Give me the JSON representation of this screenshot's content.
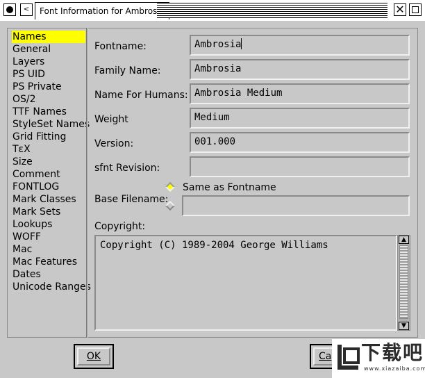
{
  "window": {
    "title": "Font Information for Ambrosia",
    "menu_glyph": "<",
    "close_glyph": "✕"
  },
  "sidebar": {
    "items": [
      {
        "label": "Names",
        "selected": true
      },
      {
        "label": "General"
      },
      {
        "label": "Layers"
      },
      {
        "label": "PS UID"
      },
      {
        "label": "PS Private"
      },
      {
        "label": "OS/2"
      },
      {
        "label": "TTF Names"
      },
      {
        "label": "StyleSet Names"
      },
      {
        "label": "Grid Fitting"
      },
      {
        "label": "TεX"
      },
      {
        "label": "Size"
      },
      {
        "label": "Comment"
      },
      {
        "label": "FONTLOG"
      },
      {
        "label": "Mark Classes"
      },
      {
        "label": "Mark Sets"
      },
      {
        "label": "Lookups"
      },
      {
        "label": "WOFF"
      },
      {
        "label": "Mac"
      },
      {
        "label": "Mac Features"
      },
      {
        "label": "Dates"
      },
      {
        "label": "Unicode Ranges"
      }
    ]
  },
  "fields": {
    "fontname": {
      "label": "Fontname:",
      "value": "Ambrosia"
    },
    "family_name": {
      "label": "Family Name:",
      "value": "Ambrosia"
    },
    "name_for_humans": {
      "label": "Name For Humans:",
      "value": "Ambrosia Medium"
    },
    "weight": {
      "label": "Weight",
      "value": "Medium"
    },
    "version": {
      "label": "Version:",
      "value": "001.000"
    },
    "sfnt_revision": {
      "label": "sfnt Revision:",
      "value": ""
    },
    "base_filename": {
      "label": "Base Filename:",
      "value": ""
    }
  },
  "base_filename_options": {
    "same_as_fontname": "Same as Fontname",
    "selected": "same_as_fontname"
  },
  "copyright": {
    "label": "Copyright:",
    "value": "Copyright (C) 1989-2004 George Williams"
  },
  "buttons": {
    "ok": "OK",
    "cancel": "Ca"
  },
  "watermark": {
    "text": "下载吧",
    "sub": "www.xiazaiba.com"
  },
  "colors": {
    "selection": "#ffff00",
    "window_bg": "#c8c8c8"
  }
}
